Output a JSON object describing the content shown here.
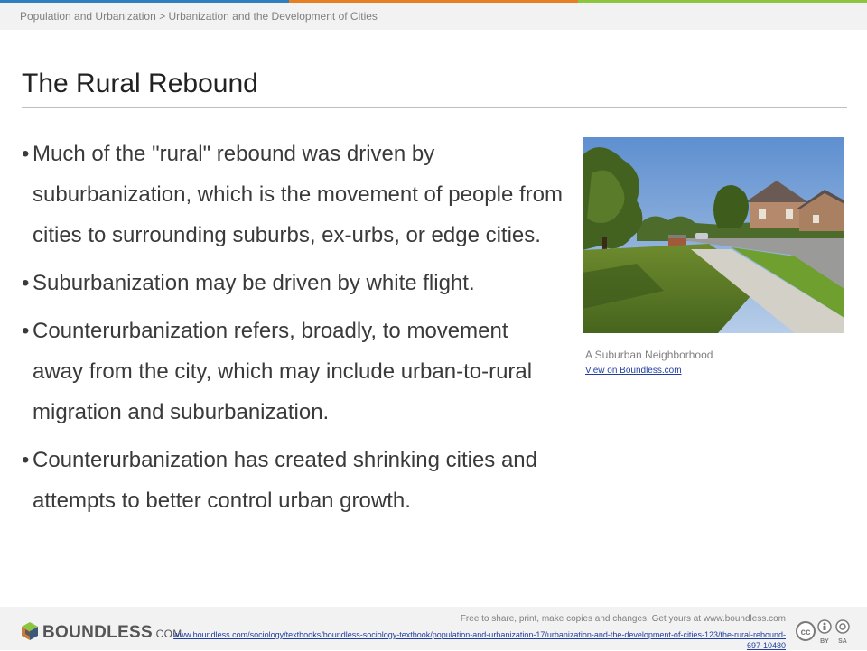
{
  "header": {
    "breadcrumb": "Population and Urbanization > Urbanization and the Development of Cities",
    "stripe_colors": [
      "#2f7fbf",
      "#e67e22",
      "#8cc63f"
    ]
  },
  "slide": {
    "title": "The Rural Rebound",
    "bullets": [
      "Much of the \"rural\" rebound was driven by suburbanization, which is the movement of people from cities to surrounding suburbs, ex-urbs, or edge cities.",
      "Suburbanization may be driven by white flight.",
      "Counterurbanization refers, broadly, to movement away from the city, which may include urban-to-rural migration and suburbanization.",
      "Counterurbanization has created shrinking cities and attempts to better control urban growth."
    ],
    "bullet_char": "•"
  },
  "figure": {
    "caption": "A Suburban Neighborhood",
    "link_text": "View on Boundless.com"
  },
  "footer": {
    "logo_text": "BOUNDLESS",
    "logo_suffix": ".COM",
    "license_text": "Free to share, print, make copies and changes. Get yours at www.boundless.com",
    "url": "www.boundless.com/sociology/textbooks/boundless-sociology-textbook/population-and-urbanization-17/urbanization-and-the-development-of-cities-123/the-rural-rebound-697-10480",
    "icons": [
      "cc-icon",
      "by-icon",
      "sa-icon"
    ]
  }
}
